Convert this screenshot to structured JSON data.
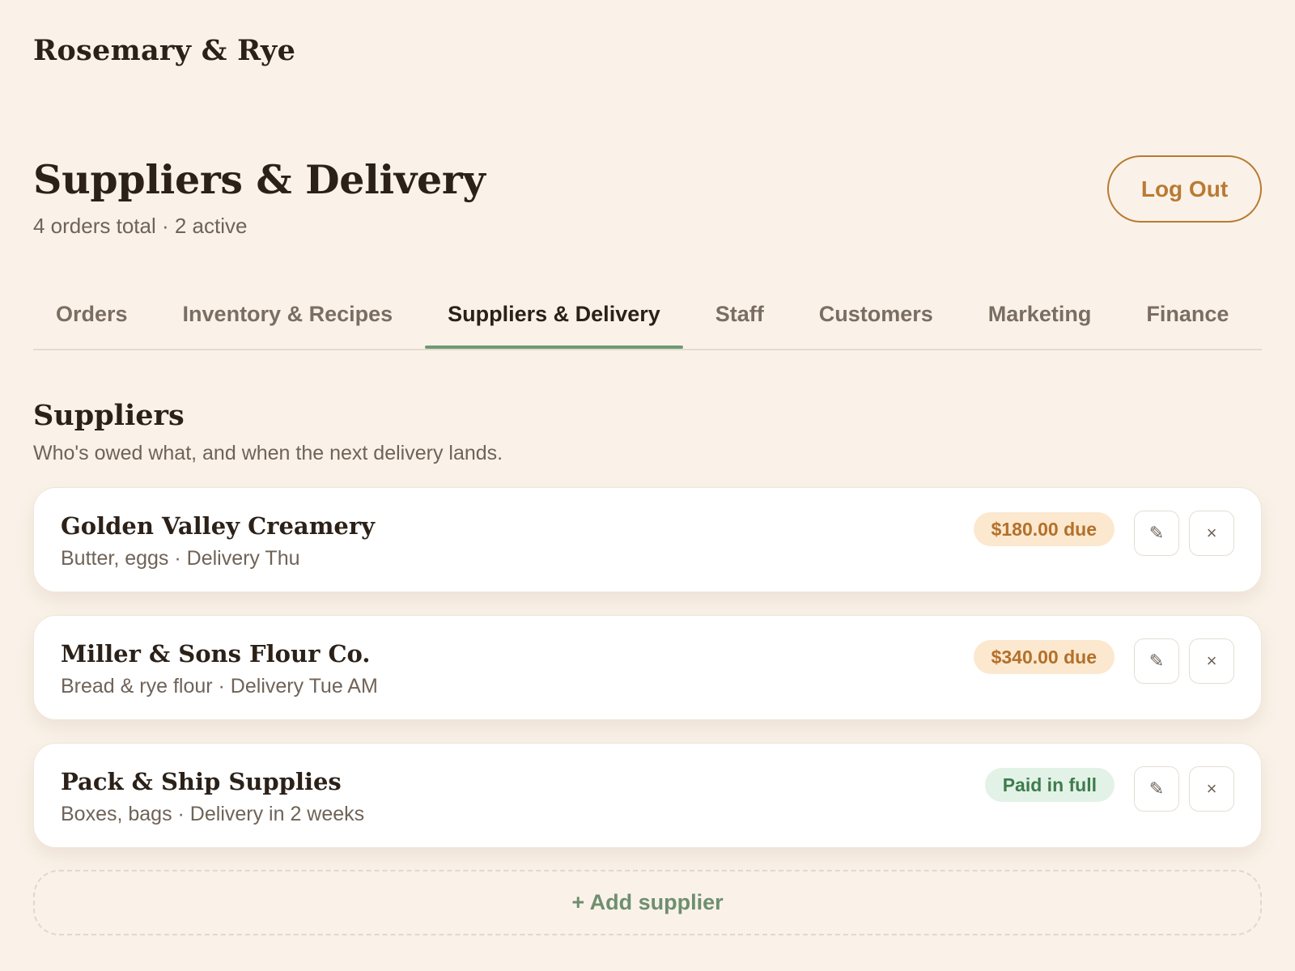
{
  "brand": {
    "name": "Rosemary & Rye"
  },
  "header": {
    "title": "Suppliers & Delivery",
    "subtitle": "4 orders total · 2 active",
    "logout_label": "Log Out"
  },
  "tabs": [
    {
      "label": "Orders",
      "active": false
    },
    {
      "label": "Inventory & Recipes",
      "active": false
    },
    {
      "label": "Suppliers & Delivery",
      "active": true
    },
    {
      "label": "Staff",
      "active": false
    },
    {
      "label": "Customers",
      "active": false
    },
    {
      "label": "Marketing",
      "active": false
    },
    {
      "label": "Finance",
      "active": false
    }
  ],
  "section": {
    "title": "Suppliers",
    "subtitle": "Who's owed what, and when the next delivery lands."
  },
  "suppliers": [
    {
      "name": "Golden Valley Creamery",
      "meta": "Butter, eggs · Delivery Thu",
      "badge": "$180.00 due",
      "status": "due"
    },
    {
      "name": "Miller & Sons Flour Co.",
      "meta": "Bread & rye flour · Delivery Tue AM",
      "badge": "$340.00 due",
      "status": "due"
    },
    {
      "name": "Pack & Ship Supplies",
      "meta": "Boxes, bags · Delivery in 2 weeks",
      "badge": "Paid in full",
      "status": "paid"
    }
  ],
  "icons": {
    "edit": "pencil-icon",
    "delete": "close-icon"
  },
  "add_supplier_label": "+ Add supplier",
  "colors": {
    "background": "#faf2e8",
    "accent_orange": "#b97a33",
    "accent_green": "#6e9a73",
    "due_badge_bg": "#fbe8cf",
    "paid_badge_bg": "#e3f2e6"
  }
}
